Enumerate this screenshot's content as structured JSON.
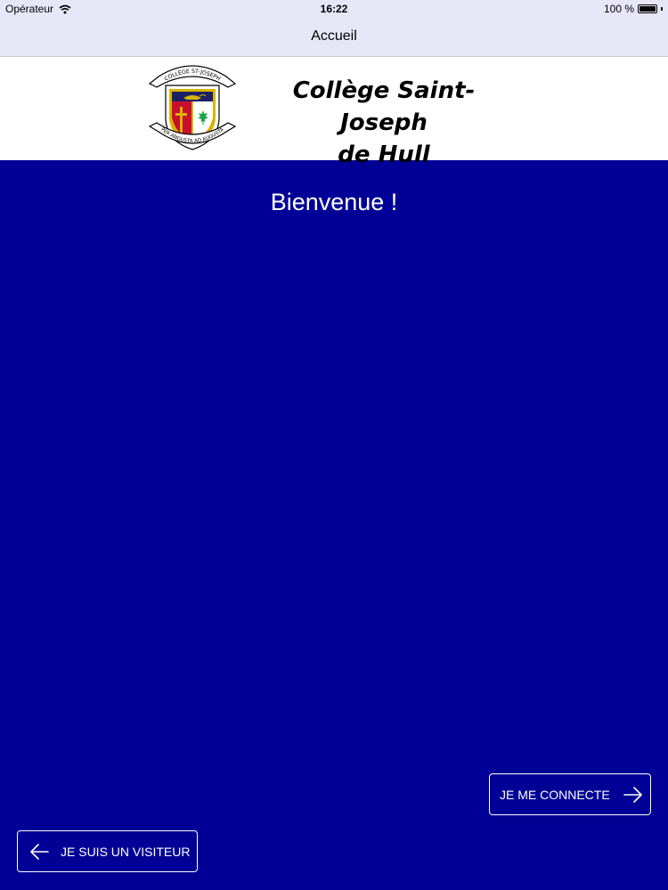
{
  "status_bar": {
    "carrier": "Opérateur",
    "time": "16:22",
    "battery": "100 %",
    "battery_level": 1.0,
    "wifi_icon": "wifi-icon",
    "battery_icon": "battery-icon"
  },
  "nav": {
    "title": "Accueil"
  },
  "header": {
    "logo_icon": "school-crest-logo",
    "logo_text_top": "COLLÈGE ST-JOSEPH",
    "logo_text_bottom": "PER ANGUSTA AD AUGUSTA",
    "name_line1": "Collège Saint-Joseph",
    "name_line2": "de Hull"
  },
  "main": {
    "welcome": "Bienvenue !",
    "connect_label": "JE ME CONNECTE",
    "connect_icon": "arrow-right-icon",
    "visitor_label": "JE SUIS UN VISITEUR",
    "visitor_icon": "arrow-left-icon"
  },
  "colors": {
    "background": "#000096",
    "bar": "#e6e6f7",
    "banner": "#ffffff",
    "text_light": "#ffffff",
    "crest_navy": "#1d2066",
    "crest_red": "#c8102e",
    "crest_gold": "#d9b400",
    "maple_green": "#1ea34a"
  }
}
